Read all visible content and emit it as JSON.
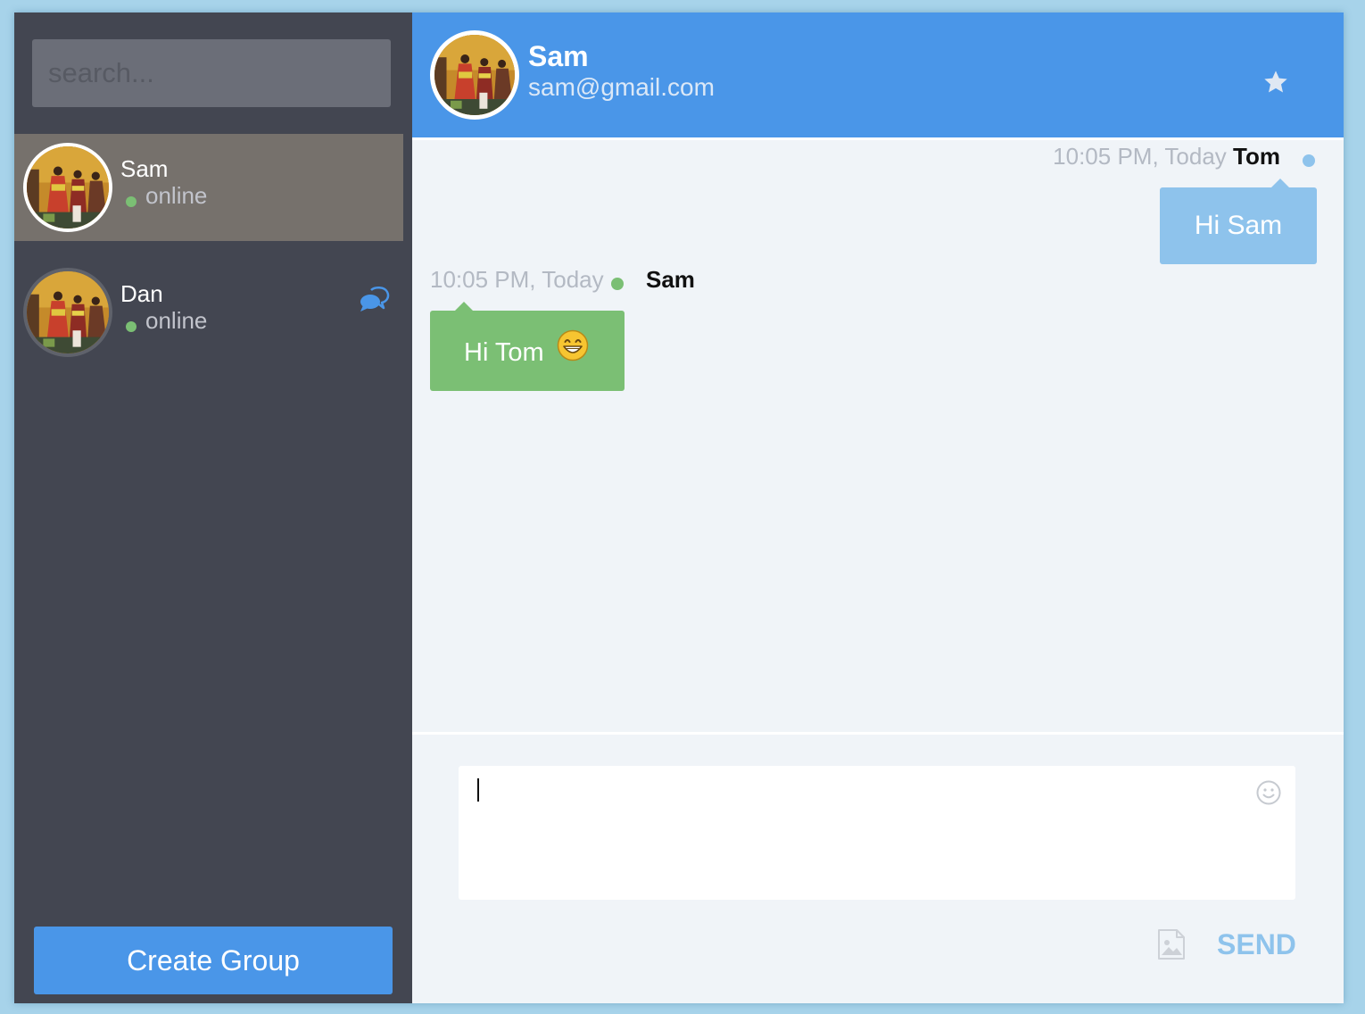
{
  "search": {
    "placeholder": "search..."
  },
  "contacts": [
    {
      "name": "Sam",
      "status": "online",
      "selected": true,
      "has_new_message": false
    },
    {
      "name": "Dan",
      "status": "online",
      "selected": false,
      "has_new_message": true
    }
  ],
  "create_group_label": "Create Group",
  "chat_header": {
    "name": "Sam",
    "email": "sam@gmail.com",
    "favorite_icon": "star-icon"
  },
  "messages": [
    {
      "time": "10:05 PM, Today",
      "author": "Tom",
      "text": "Hi Sam",
      "outgoing": true
    },
    {
      "time": "10:05 PM, Today",
      "author": "Sam",
      "text": "Hi Tom",
      "emoji_icon": "grinning-face-emoji",
      "outgoing": false
    }
  ],
  "composer": {
    "value": "",
    "emoji_icon": "smiley-icon",
    "attach_icon": "image-icon",
    "send_label": "SEND"
  },
  "icons": {
    "new_message": "chat-bubbles-icon"
  },
  "colors": {
    "accent": "#4a96e8",
    "sidebar_bg": "#434651",
    "selected_contact_bg": "#76716c",
    "online": "#7bbf74",
    "outgoing_bubble": "#8ec3ec",
    "incoming_bubble": "#7bbf74",
    "timestamp": "#b3b9c3",
    "send_label": "#8ec3ec",
    "chat_bg": "#f0f4f8"
  }
}
